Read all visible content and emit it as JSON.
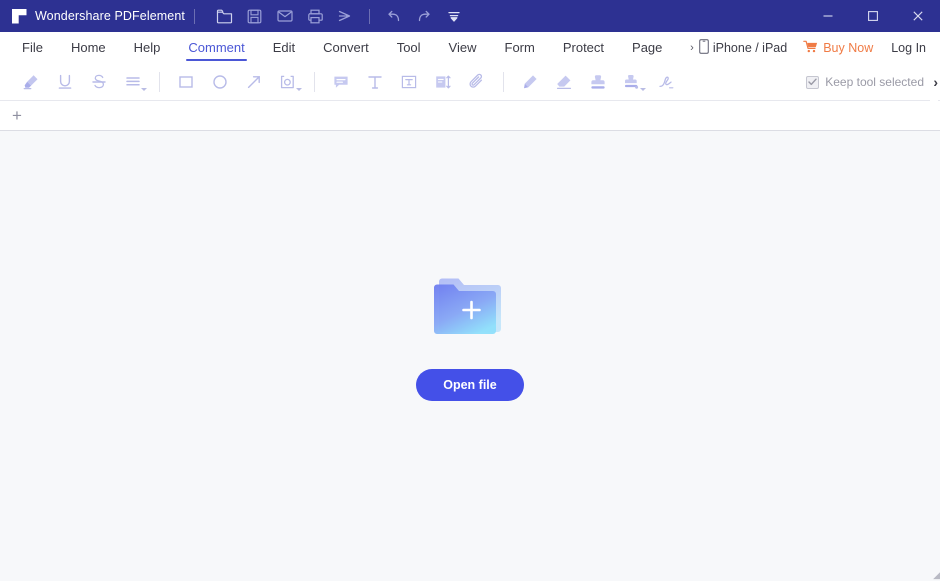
{
  "window": {
    "app_title": "Wondershare PDFelement",
    "logo_icon": "pdfelement-logo-icon",
    "quick_access": [
      {
        "name": "open-folder-icon",
        "tooltip": "Open"
      },
      {
        "name": "save-icon",
        "tooltip": "Save"
      },
      {
        "name": "email-icon",
        "tooltip": "Email"
      },
      {
        "name": "print-icon",
        "tooltip": "Print"
      },
      {
        "name": "send-icon",
        "tooltip": "Send"
      },
      {
        "name": "undo-icon",
        "tooltip": "Undo"
      },
      {
        "name": "redo-icon",
        "tooltip": "Redo"
      },
      {
        "name": "customize-dropdown-icon",
        "tooltip": "Customize Quick Access Toolbar"
      }
    ],
    "controls": [
      {
        "name": "minimize-button",
        "glyph": "minimize"
      },
      {
        "name": "maximize-button",
        "glyph": "maximize"
      },
      {
        "name": "close-button",
        "glyph": "close"
      }
    ]
  },
  "menubar": {
    "tabs": [
      {
        "label": "File",
        "active": false
      },
      {
        "label": "Home",
        "active": false
      },
      {
        "label": "Help",
        "active": false
      },
      {
        "label": "Comment",
        "active": true
      },
      {
        "label": "Edit",
        "active": false
      },
      {
        "label": "Convert",
        "active": false
      },
      {
        "label": "Tool",
        "active": false
      },
      {
        "label": "View",
        "active": false
      },
      {
        "label": "Form",
        "active": false
      },
      {
        "label": "Protect",
        "active": false
      },
      {
        "label": "Page",
        "active": false
      }
    ],
    "device_label": "iPhone / iPad",
    "device_icon": "phone-icon",
    "device_chevron": "chevron-right-icon",
    "buy_label": "Buy Now",
    "buy_icon": "shopping-cart-icon",
    "login_label": "Log In"
  },
  "toolbar": {
    "tools": [
      {
        "name": "highlight-tool",
        "label": "Highlight",
        "icon": "highlighter-icon",
        "dropdown": false
      },
      {
        "name": "underline-tool",
        "label": "Underline",
        "icon": "underline-icon",
        "dropdown": false
      },
      {
        "name": "strikethrough-tool",
        "label": "Strikethrough",
        "icon": "strikethrough-icon",
        "dropdown": false
      },
      {
        "name": "more-markup-tool",
        "label": "More Markup",
        "icon": "lines-icon",
        "dropdown": true
      },
      {
        "name": "rectangle-tool",
        "label": "Rectangle",
        "icon": "rectangle-icon",
        "dropdown": false
      },
      {
        "name": "ellipse-tool",
        "label": "Ellipse",
        "icon": "ellipse-icon",
        "dropdown": false
      },
      {
        "name": "arrow-tool",
        "label": "Arrow",
        "icon": "arrow-icon",
        "dropdown": false
      },
      {
        "name": "shapes-tool",
        "label": "Shapes",
        "icon": "shapes-area-icon",
        "dropdown": true
      },
      {
        "name": "note-tool",
        "label": "Note",
        "icon": "comment-bubble-icon",
        "dropdown": false
      },
      {
        "name": "text-tool",
        "label": "Text",
        "icon": "text-t-icon",
        "dropdown": false
      },
      {
        "name": "textbox-tool",
        "label": "Text Box",
        "icon": "text-box-icon",
        "dropdown": false
      },
      {
        "name": "callout-tool",
        "label": "Callout",
        "icon": "callout-icon",
        "dropdown": false
      },
      {
        "name": "attachment-tool",
        "label": "Attachment",
        "icon": "paperclip-icon",
        "dropdown": false
      },
      {
        "name": "pencil-tool",
        "label": "Pencil",
        "icon": "pencil-icon",
        "dropdown": false
      },
      {
        "name": "eraser-tool",
        "label": "Eraser",
        "icon": "eraser-icon",
        "dropdown": false
      },
      {
        "name": "stamp-tool",
        "label": "Stamp",
        "icon": "stamp-icon",
        "dropdown": false
      },
      {
        "name": "custom-stamp-tool",
        "label": "Custom Stamp",
        "icon": "stamp-dropdown-icon",
        "dropdown": true
      },
      {
        "name": "signature-tool",
        "label": "Signature",
        "icon": "signature-icon",
        "dropdown": false
      }
    ],
    "keep_tool_label": "Keep tool selected",
    "keep_tool_checked": true,
    "overflow_glyph": "›"
  },
  "tabstrip": {
    "new_tab_label": "+",
    "new_tab_icon": "plus-icon"
  },
  "content": {
    "folder_icon": "folder-plus-icon",
    "open_file_label": "Open file"
  },
  "colors": {
    "titlebar": "#2d3192",
    "accent": "#4b57d6",
    "button": "#4450e8",
    "buy_now": "#f07b45",
    "canvas": "#f7f8fa",
    "tool_icon": "#b8bbe8"
  }
}
